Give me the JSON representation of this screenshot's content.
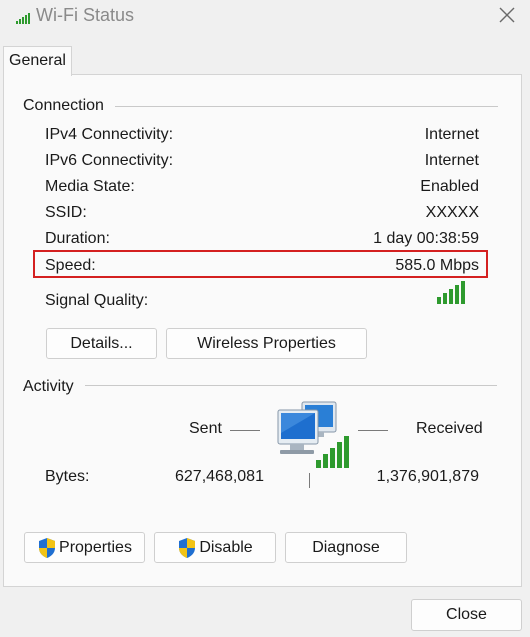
{
  "window": {
    "title": "Wi-Fi Status",
    "close_icon": "close-icon"
  },
  "tabs": [
    {
      "label": "General"
    }
  ],
  "connection": {
    "group_label": "Connection",
    "rows": [
      {
        "label": "IPv4 Connectivity:",
        "value": "Internet"
      },
      {
        "label": "IPv6 Connectivity:",
        "value": "Internet"
      },
      {
        "label": "Media State:",
        "value": "Enabled"
      },
      {
        "label": "SSID:",
        "value": "XXXXX"
      },
      {
        "label": "Duration:",
        "value": "1 day 00:38:59"
      },
      {
        "label": "Speed:",
        "value": "585.0 Mbps"
      }
    ],
    "signal_label": "Signal Quality:",
    "signal_bars_filled": 5,
    "signal_bars_total": 5,
    "details_button": "Details...",
    "wireless_properties_button": "Wireless Properties"
  },
  "activity": {
    "group_label": "Activity",
    "sent_label": "Sent",
    "received_label": "Received",
    "bytes_label": "Bytes:",
    "bytes_sent": "627,468,081",
    "bytes_received": "1,376,901,879"
  },
  "actions": {
    "properties_button": "Properties",
    "disable_button": "Disable",
    "diagnose_button": "Diagnose"
  },
  "footer": {
    "close_button": "Close"
  },
  "colors": {
    "highlight_border": "#d42020",
    "signal_green": "#2e9a2e",
    "shield_blue": "#1f6fd1",
    "shield_yellow": "#f2c316"
  }
}
